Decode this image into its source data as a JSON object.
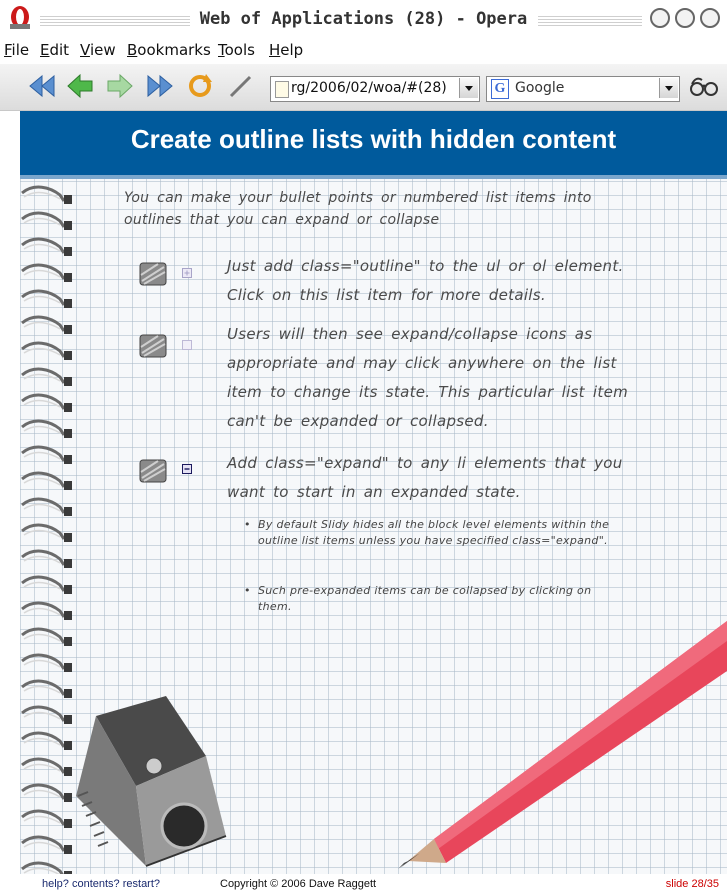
{
  "window": {
    "title": "Web of Applications (28) - Opera"
  },
  "menubar": {
    "items": [
      "File",
      "Edit",
      "View",
      "Bookmarks",
      "Tools",
      "Help"
    ]
  },
  "toolbar": {
    "buttons": [
      "rewind-icon",
      "back-icon",
      "forward-icon",
      "fast-forward-icon",
      "reload-icon",
      "edit-icon"
    ],
    "address": "rg/2006/02/woa/#(28)",
    "search_engine": "Google",
    "search_logo": "G"
  },
  "slide": {
    "title": "Create outline lists with hidden content",
    "intro": "You can make your bullet points or numbered list items into outlines that you can expand or collapse",
    "items": [
      {
        "text": "Just add class=\"outline\" to the ul or ol element. Click on this list item for more details.",
        "state": "folded"
      },
      {
        "text": "Users will then see expand/collapse icons as appropriate and may click anywhere on the list item to change its state. This particular list item can't be expanded or collapsed.",
        "state": "nofold"
      },
      {
        "text": "Add class=\"expand\" to any li elements that you want to start in an expanded state.",
        "state": "unfolded",
        "subitems": [
          "By default Slidy hides all the block level elements within the outline list items unless you have specified class=\"expand\".",
          "Such pre-expanded items can be collapsed by clicking on them."
        ]
      }
    ]
  },
  "footer": {
    "links": "help? contents? restart?",
    "copyright": "Copyright © 2006 Dave Raggett",
    "slide_number": "slide 28/35"
  },
  "colors": {
    "banner": "#005a9c",
    "slide_number": "#cc0000",
    "pencil": "#e8465b"
  }
}
